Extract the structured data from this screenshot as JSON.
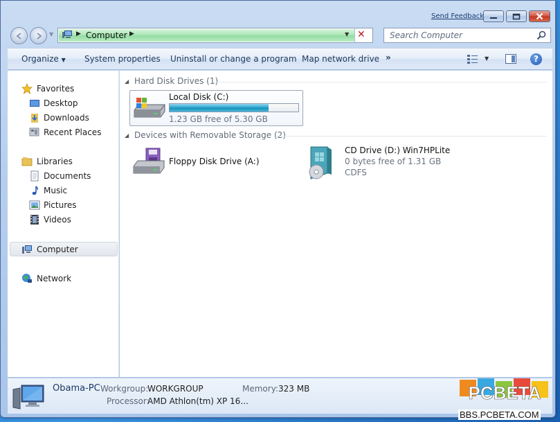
{
  "window": {
    "send_feedback": "Send Feedback",
    "controls": {
      "minimize": "minimize",
      "maximize": "maximize",
      "close": "close"
    }
  },
  "address": {
    "path": "Computer",
    "search_placeholder": "Search Computer"
  },
  "toolbar": {
    "organize": "Organize",
    "system_properties": "System properties",
    "uninstall": "Uninstall or change a program",
    "map_drive": "Map network drive",
    "more": "»",
    "help": "?"
  },
  "nav": {
    "favorites": "Favorites",
    "desktop": "Desktop",
    "downloads": "Downloads",
    "recent": "Recent Places",
    "libraries": "Libraries",
    "documents": "Documents",
    "music": "Music",
    "pictures": "Pictures",
    "videos": "Videos",
    "computer": "Computer",
    "network": "Network"
  },
  "groups": {
    "hdd": "Hard Disk Drives (1)",
    "removable": "Devices with Removable Storage (2)"
  },
  "drives": {
    "c": {
      "name": "Local Disk (C:)",
      "free": "1.23 GB free of 5.30 GB",
      "used_fraction": 0.77
    },
    "a": {
      "name": "Floppy Disk Drive (A:)"
    },
    "d": {
      "name": "CD Drive (D:) Win7HPLite",
      "free": "0 bytes free of 1.31 GB",
      "fs": "CDFS"
    }
  },
  "status": {
    "computer_name": "Obama-PC",
    "workgroup_label": "Workgroup:",
    "workgroup": "WORKGROUP",
    "memory_label": "Memory:",
    "memory": "323 MB",
    "processor_label": "Processor:",
    "processor": "AMD Athlon(tm) XP 16..."
  },
  "watermark": {
    "logo": "PCBETA",
    "url": "BBS.PCBETA.COM"
  },
  "colors": {
    "progress": "#1f9bc4",
    "address_green": "#a8e6b2",
    "toolbar_text": "#1e395b"
  }
}
